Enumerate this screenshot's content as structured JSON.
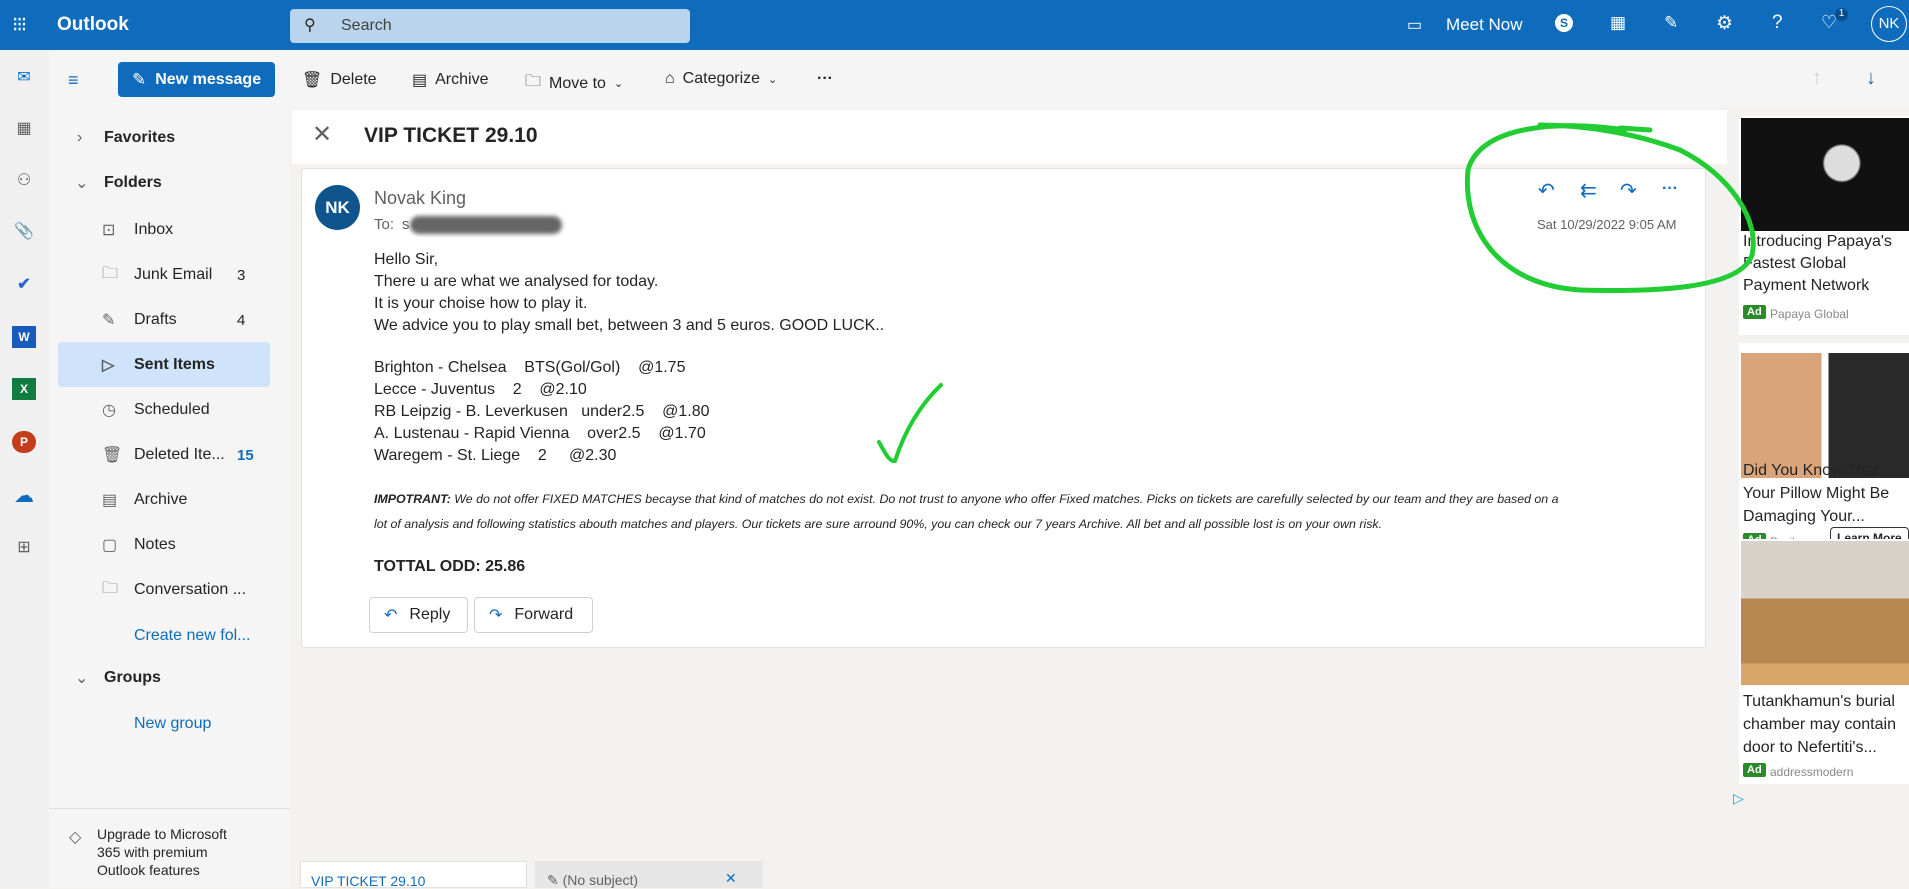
{
  "app": {
    "title": "Outlook",
    "search_placeholder": "Search",
    "meet_now": "Meet Now",
    "avatar": "NK",
    "notif_count": "1",
    "brand": "#0f6cbd"
  },
  "toolbar": {
    "new_message": "New message",
    "delete": "Delete",
    "archive": "Archive",
    "move_to": "Move to",
    "categorize": "Categorize",
    "more": "···"
  },
  "folders": {
    "favorites": "Favorites",
    "folders": "Folders",
    "items": [
      {
        "label": "Inbox",
        "icon": "inbox-icon",
        "count": ""
      },
      {
        "label": "Junk Email",
        "icon": "junk-icon",
        "count": "3"
      },
      {
        "label": "Drafts",
        "icon": "drafts-icon",
        "count": "4"
      },
      {
        "label": "Sent Items",
        "icon": "send-icon",
        "count": ""
      },
      {
        "label": "Scheduled",
        "icon": "clock-icon",
        "count": ""
      },
      {
        "label": "Deleted Ite...",
        "icon": "trash-icon",
        "count": "15"
      },
      {
        "label": "Archive",
        "icon": "archive-icon",
        "count": ""
      },
      {
        "label": "Notes",
        "icon": "notes-icon",
        "count": ""
      },
      {
        "label": "Conversation ...",
        "icon": "folder-icon",
        "count": ""
      }
    ],
    "create_new": "Create new fol...",
    "groups": "Groups",
    "new_group": "New group",
    "upgrade": [
      "Upgrade to Microsoft",
      "365 with premium",
      "Outlook features"
    ]
  },
  "email": {
    "subject": "VIP TICKET 29.10",
    "sender": "Novak King",
    "sender_initials": "NK",
    "to_label": "To:",
    "to_value": "s",
    "date": "Sat 10/29/2022 9:05 AM",
    "greeting": [
      "Hello Sir,",
      "There u are what we analysed for today.",
      "It is your choise how to play it.",
      "We advice you to play small bet, between 3 and 5 euros. GOOD LUCK.."
    ],
    "picks": [
      "Brighton - Chelsea    BTS(Gol/Gol)    @1.75",
      "Lecce - Juventus    2    @2.10",
      "RB Leipzig - B. Leverkusen   under2.5    @1.80",
      "A. Lustenau - Rapid Vienna    over2.5    @1.70",
      "Waregem - St. Liege    2     @2.30"
    ],
    "important_label": "IMPOTRANT:",
    "important_line1": " We do not offer FIXED MATCHES becayse that kind of matches do not exist. Do not trust to anyone who offer Fixed matches. Picks on tickets are carefully selected by our team and they are based on a",
    "important_line2": "lot of analysis and following statistics abouth matches and players. Our tickets are sure arround 90%, you can check our 7 years Archive. All bet and all possible lost is on your own risk.",
    "total": "TOTTAL ODD: 25.86",
    "reply": "Reply",
    "forward": "Forward"
  },
  "ads": [
    {
      "title": [
        "Introducing Papaya's",
        "Fastest Global",
        "Payment Network"
      ],
      "badge": "Ad",
      "source": "Papaya Global"
    },
    {
      "title": [
        "Did You Know That",
        "Your Pillow Might Be",
        "Damaging Your..."
      ],
      "badge": "Ad",
      "source": "Derila",
      "cta": "Learn More"
    },
    {
      "title": [
        "Tutankhamun's burial",
        "chamber may contain",
        "door to Nefertiti's..."
      ],
      "badge": "Ad",
      "source": "addressmodern"
    }
  ],
  "bottom_tabs": [
    {
      "label": "VIP TICKET 29.10"
    },
    {
      "label": "(No subject)"
    }
  ],
  "annotation_color": "#22cc33"
}
